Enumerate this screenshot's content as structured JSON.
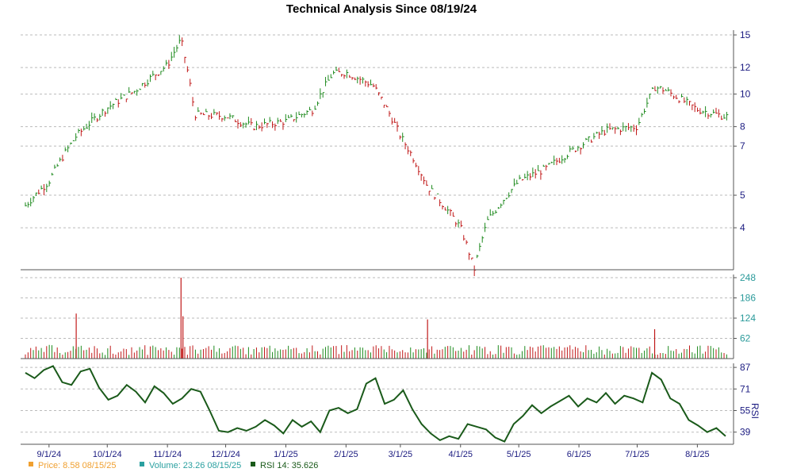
{
  "chart_data": {
    "type": "line",
    "title": "Technical Analysis Since 08/19/24",
    "price_panel": {
      "yticks": [
        "4",
        "5",
        "7",
        "8",
        "10",
        "12",
        "15"
      ],
      "ylim": [
        3,
        15.5
      ],
      "x": [
        "8/19/24",
        "9/1/24",
        "9/15/24",
        "10/1/24",
        "10/15/24",
        "11/1/24",
        "11/8/24",
        "11/15/24",
        "12/1/24",
        "12/15/24",
        "1/1/25",
        "1/15/25",
        "1/25/25",
        "2/1/25",
        "2/15/25",
        "3/1/25",
        "3/15/25",
        "4/1/25",
        "4/8/25",
        "4/15/25",
        "5/1/25",
        "5/15/25",
        "6/1/25",
        "6/15/25",
        "7/1/25",
        "7/10/25",
        "7/15/25",
        "8/1/25",
        "8/15/25"
      ],
      "close": [
        4.6,
        5.5,
        7.5,
        9.1,
        10.2,
        12.2,
        14.5,
        8.7,
        8.6,
        8.0,
        8.3,
        9.0,
        11.5,
        11.6,
        10.6,
        7.5,
        5.3,
        4.0,
        3.0,
        4.2,
        5.5,
        6.0,
        7.0,
        7.8,
        8.0,
        10.5,
        10.3,
        9.0,
        8.58
      ],
      "dates_for_ticks": [
        "9/1/24",
        "10/1/24",
        "11/1/24",
        "12/1/24",
        "1/1/25",
        "2/1/25",
        "3/1/25",
        "4/1/25",
        "5/1/25",
        "6/1/25",
        "7/1/25",
        "8/1/25"
      ]
    },
    "volume_panel": {
      "yticks": [
        "62",
        "124",
        "186",
        "248"
      ],
      "ylim": [
        0,
        248
      ],
      "spikes": [
        {
          "date": "9/15/24",
          "value": 138
        },
        {
          "date": "11/8/24",
          "value": 248
        },
        {
          "date": "11/9/24",
          "value": 130
        },
        {
          "date": "3/15/25",
          "value": 120
        },
        {
          "date": "7/10/25",
          "value": 90
        }
      ],
      "typical": 28
    },
    "rsi_panel": {
      "ylabel": "RSI",
      "yticks": [
        "39",
        "55",
        "71",
        "87"
      ],
      "ylim": [
        30,
        90
      ],
      "values": [
        83,
        79,
        85,
        88,
        76,
        74,
        84,
        86,
        72,
        63,
        66,
        74,
        69,
        61,
        73,
        68,
        60,
        64,
        71,
        69,
        55,
        40,
        39,
        42,
        40,
        43,
        48,
        44,
        38,
        48,
        43,
        47,
        39,
        55,
        57,
        53,
        56,
        75,
        79,
        60,
        63,
        70,
        56,
        45,
        38,
        33,
        36,
        34,
        45,
        43,
        41,
        35,
        32,
        45,
        51,
        59,
        53,
        58,
        62,
        66,
        58,
        64,
        61,
        68,
        60,
        66,
        64,
        61,
        83,
        78,
        64,
        60,
        48,
        44,
        39,
        42,
        36
      ]
    },
    "legend": [
      {
        "label": "Price: 8.58  08/15/25",
        "color": "#f0a030"
      },
      {
        "label": "Volume: 23.26  08/15/25",
        "color": "#2aa0a0"
      },
      {
        "label": "RSI 14: 35.626",
        "color": "#1a5a1a"
      }
    ]
  }
}
